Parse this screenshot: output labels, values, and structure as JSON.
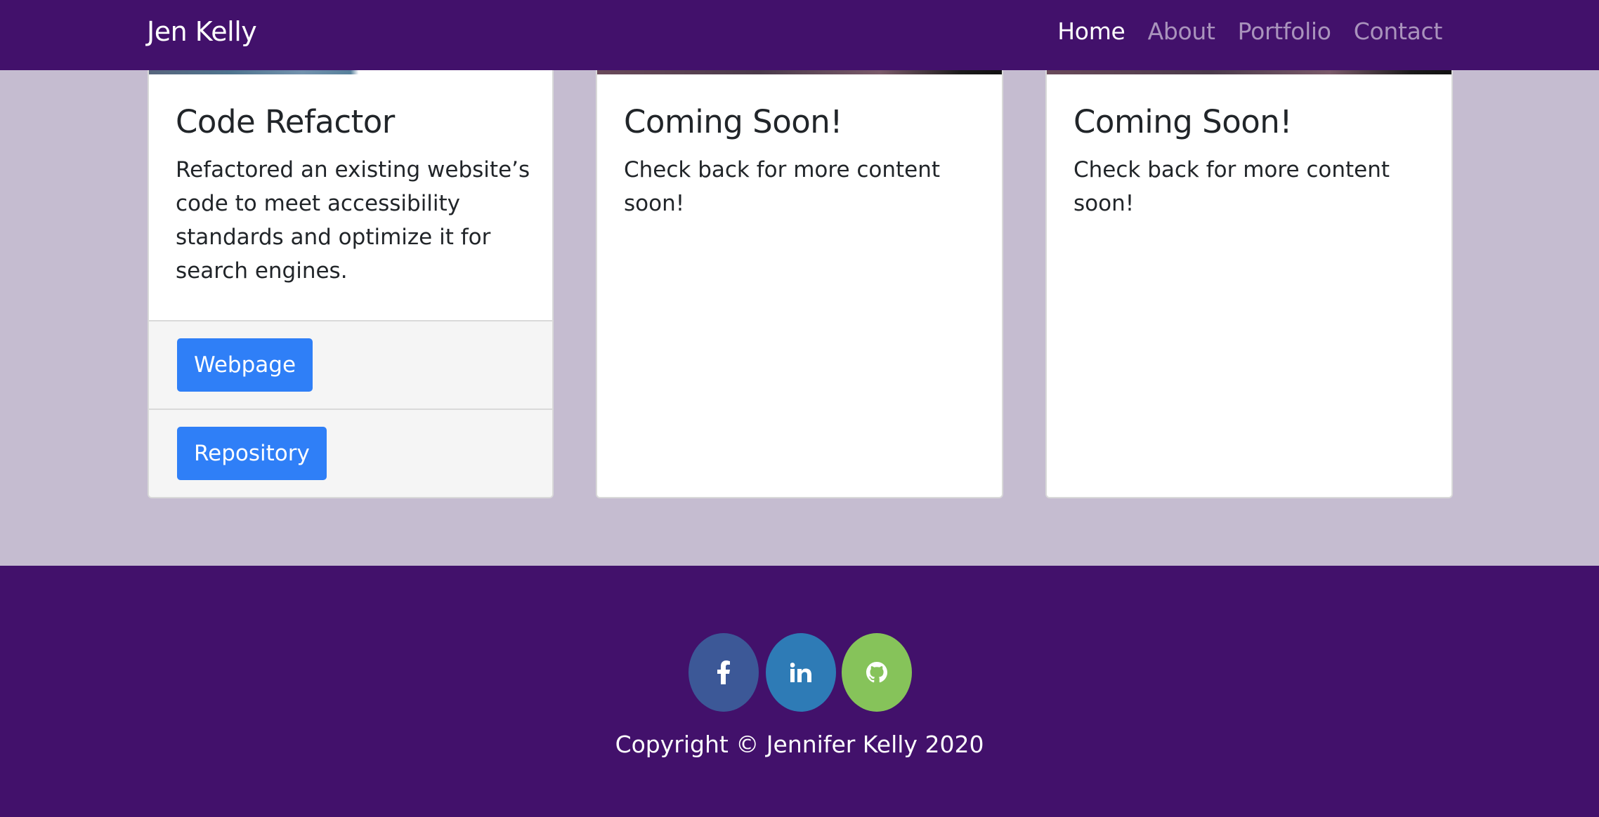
{
  "navbar": {
    "brand": "Jen Kelly",
    "links": [
      {
        "label": "Home",
        "active": true
      },
      {
        "label": "About",
        "active": false
      },
      {
        "label": "Portfolio",
        "active": false
      },
      {
        "label": "Contact",
        "active": false
      }
    ]
  },
  "cards": [
    {
      "title": "Code Refactor",
      "text": "Refactored an existing website’s code to meet accessibility standards and optimize it for search engines.",
      "buttons": [
        "Webpage",
        "Repository"
      ]
    },
    {
      "title": "Coming Soon!",
      "text": "Check back for more content soon!"
    },
    {
      "title": "Coming Soon!",
      "text": "Check back for more content soon!"
    }
  ],
  "footer": {
    "social": [
      {
        "name": "facebook",
        "icon": "facebook-icon",
        "color": "#3c5897"
      },
      {
        "name": "linkedin",
        "icon": "linkedin-icon",
        "color": "#2e7bb6"
      },
      {
        "name": "github",
        "icon": "github-icon",
        "color": "#86c35a"
      }
    ],
    "copyright": "Copyright © Jennifer Kelly 2020"
  },
  "colors": {
    "primary": "#42116b",
    "background": "#c5bcd0",
    "button": "#2f7ff7"
  }
}
